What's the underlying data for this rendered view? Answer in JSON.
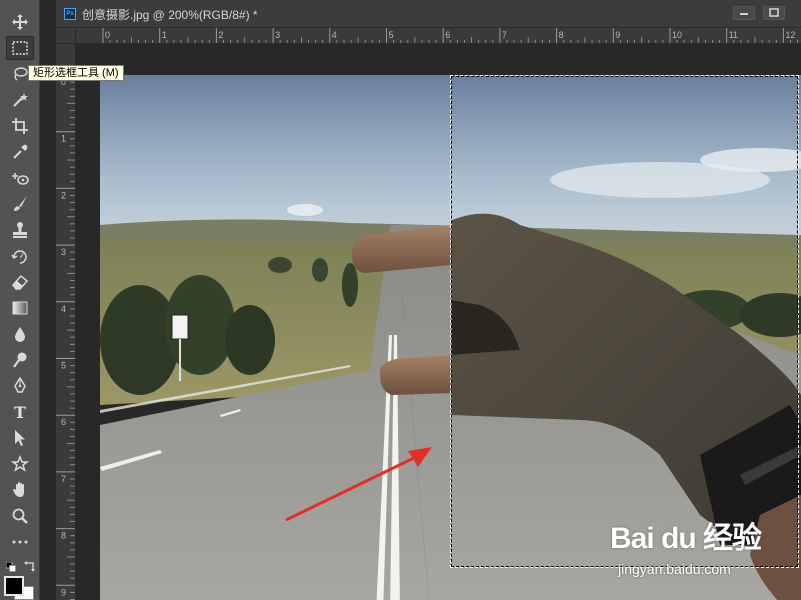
{
  "document": {
    "tab_title": "创意摄影.jpg @ 200%(RGB/8#) *",
    "app_badge": "Ps"
  },
  "tooltip": {
    "text": "矩形选框工具 (M)"
  },
  "rulers": {
    "top_labels": [
      "0",
      "1",
      "2",
      "3",
      "4",
      "5",
      "6",
      "7",
      "8",
      "9",
      "10",
      "11",
      "12"
    ],
    "left_labels": [
      "0",
      "1",
      "2",
      "3",
      "4",
      "5",
      "6",
      "7",
      "8",
      "9"
    ]
  },
  "toolbar": {
    "tools": [
      {
        "name": "move-tool",
        "icon": "move-icon",
        "active": false
      },
      {
        "name": "rectangular-marquee-tool",
        "icon": "marquee-icon",
        "active": true
      },
      {
        "name": "lasso-tool",
        "icon": "lasso-icon",
        "active": false
      },
      {
        "name": "magic-wand-tool",
        "icon": "magic-wand-icon",
        "active": false
      },
      {
        "name": "crop-tool",
        "icon": "crop-icon",
        "active": false
      },
      {
        "name": "eyedropper-tool",
        "icon": "eyedropper-icon",
        "active": false
      },
      {
        "name": "healing-brush-tool",
        "icon": "healing-icon",
        "active": false
      },
      {
        "name": "brush-tool",
        "icon": "brush-icon",
        "active": false
      },
      {
        "name": "clone-stamp-tool",
        "icon": "stamp-icon",
        "active": false
      },
      {
        "name": "history-brush-tool",
        "icon": "history-brush-icon",
        "active": false
      },
      {
        "name": "eraser-tool",
        "icon": "eraser-icon",
        "active": false
      },
      {
        "name": "gradient-tool",
        "icon": "gradient-icon",
        "active": false
      },
      {
        "name": "blur-tool",
        "icon": "blur-icon",
        "active": false
      },
      {
        "name": "dodge-tool",
        "icon": "dodge-icon",
        "active": false
      },
      {
        "name": "pen-tool",
        "icon": "pen-icon",
        "active": false
      },
      {
        "name": "type-tool",
        "icon": "type-icon",
        "active": false
      },
      {
        "name": "path-selection-tool",
        "icon": "arrow-icon",
        "active": false
      },
      {
        "name": "custom-shape-tool",
        "icon": "shape-icon",
        "active": false
      },
      {
        "name": "hand-tool",
        "icon": "hand-icon",
        "active": false
      },
      {
        "name": "zoom-tool",
        "icon": "zoom-icon",
        "active": false
      }
    ],
    "type_glyph": "T"
  },
  "colors": {
    "foreground": "#000000",
    "background": "#ffffff"
  },
  "watermark": {
    "logo": "Bai du 经验",
    "url": "jingyan.baidu.com"
  }
}
